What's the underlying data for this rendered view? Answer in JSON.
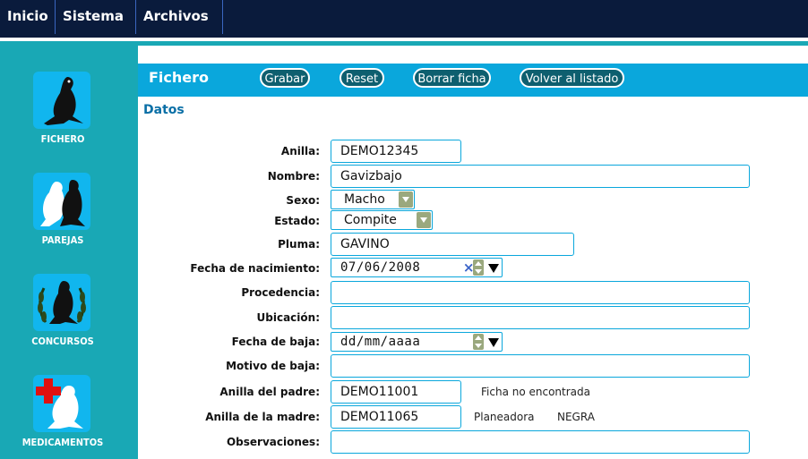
{
  "menu": {
    "items": [
      "Inicio",
      "Sistema",
      "Archivos"
    ]
  },
  "sidebar": {
    "items": [
      {
        "label": "FICHERO",
        "icon": "pigeon-icon"
      },
      {
        "label": "PAREJAS",
        "icon": "pigeon-pair-icon"
      },
      {
        "label": "CONCURSOS",
        "icon": "pigeon-laurel-icon"
      },
      {
        "label": "MEDICAMENTOS",
        "icon": "pigeon-medical-icon"
      }
    ]
  },
  "panel": {
    "title": "Fichero",
    "buttons": {
      "grabar": "Grabar",
      "reset": "Reset",
      "borrar": "Borrar ficha",
      "volver": "Volver al listado"
    }
  },
  "section": {
    "title": "Datos"
  },
  "form": {
    "anilla": {
      "label": "Anilla:",
      "value": "DEMO12345"
    },
    "nombre": {
      "label": "Nombre:",
      "value": "Gavizbajo"
    },
    "sexo": {
      "label": "Sexo:",
      "value": "Macho"
    },
    "estado": {
      "label": "Estado:",
      "value": "Compite"
    },
    "pluma": {
      "label": "Pluma:",
      "value": "GAVINO"
    },
    "fecha_nacimiento": {
      "label": "Fecha de nacimiento:",
      "value": "07/06/2008"
    },
    "procedencia": {
      "label": "Procedencia:",
      "value": ""
    },
    "ubicacion": {
      "label": "Ubicación:",
      "value": ""
    },
    "fecha_baja": {
      "label": "Fecha de baja:",
      "placeholder": "dd/mm/aaaa"
    },
    "motivo_baja": {
      "label": "Motivo de baja:",
      "value": ""
    },
    "anilla_padre": {
      "label": "Anilla del padre:",
      "value": "DEMO11001",
      "note": "Ficha no encontrada"
    },
    "anilla_madre": {
      "label": "Anilla de la madre:",
      "value": "DEMO11065",
      "note_name": "Planeadora",
      "note_color": "NEGRA"
    },
    "observaciones": {
      "label": "Observaciones:",
      "value": ""
    }
  },
  "colors": {
    "menu_bg": "#0a1b3c",
    "sidebar_bg": "#19a8b5",
    "header_bg": "#0aa7dc",
    "icon_bg": "#11b6ee",
    "accent_text": "#0a6fa6",
    "clear_x": "#3b64c8"
  }
}
